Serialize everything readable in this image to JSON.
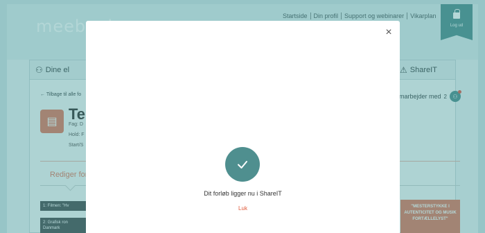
{
  "header": {
    "logo_text": "meebook",
    "links": [
      "Startside",
      "Din profil",
      "Support og webinarer",
      "Vikarplan"
    ],
    "logout_label": "Log ud"
  },
  "nav": {
    "tab_left_label": "Dine el",
    "tab_right_label": "ShareIT"
  },
  "content": {
    "back_link": "← Tilbage til alle fo",
    "course_title": "Te",
    "meta_fag": "Fag: D",
    "meta_hold": "Hold: F",
    "meta_start": "Start/S",
    "collaborators_label": "marbejder med",
    "collaborators_count": "2",
    "edit_tab_label": "Rediger for",
    "list_items": [
      "1: Filmen: \"Hv",
      "2: Grafisk ron Danmark"
    ],
    "poster_text": "\"MESTERSTYKKE I AUTENTICITET OG MUSIK FORTÆLLELYST\""
  },
  "modal": {
    "message": "Dit forløb ligger nu i ShareIT",
    "close_link": "Luk",
    "close_icon": "×"
  },
  "colors": {
    "accent": "#4f8f8f",
    "link": "#e05a3a",
    "overlay": "rgba(60,150,150,0.38)"
  }
}
